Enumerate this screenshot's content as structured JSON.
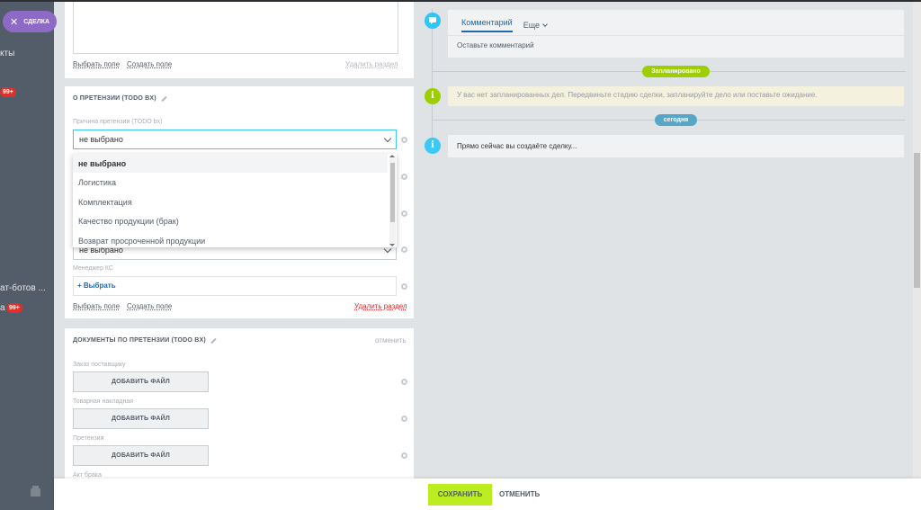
{
  "deal_pill": {
    "label": "СДЕЛКА"
  },
  "left_nav": {
    "items": [
      {
        "label": "кты"
      },
      {
        "label": "ат-ботов ..."
      },
      {
        "label": "а"
      }
    ],
    "badges": [
      "99+",
      "99+"
    ]
  },
  "card1": {
    "select_field": "Выбрать поле",
    "create_field": "Создать поле",
    "delete_section": "Удалить раздел"
  },
  "claim_section": {
    "title": "О ПРЕТЕНЗИИ (TODO BX)",
    "reason_label": "Причина претензии (TODO bx)",
    "reason_value": "не выбрано",
    "second_select_value": "не выбрано",
    "manager_label": "Менеджер КС",
    "pick_button": "+ Выбрать",
    "select_field": "Выбрать поле",
    "create_field": "Создать поле",
    "delete_section": "Удалить раздел"
  },
  "dropdown": {
    "options": [
      "не выбрано",
      "Логистика",
      "Комплектация",
      "Качество продукции (брак)",
      "Возврат просроченной продукции"
    ]
  },
  "docs_section": {
    "title": "ДОКУМЕНТЫ ПО ПРЕТЕНЗИИ (TODO BX)",
    "cancel": "отменить",
    "fields": [
      {
        "label": "Заказ поставщику",
        "button": "ДОБАВИТЬ ФАЙЛ"
      },
      {
        "label": "Товарная накладная",
        "button": "ДОБАВИТЬ ФАЙЛ"
      },
      {
        "label": "Претензия",
        "button": "ДОБАВИТЬ ФАЙЛ"
      },
      {
        "label": "Акт брака"
      }
    ]
  },
  "timeline": {
    "tabs": {
      "comment": "Комментарий",
      "more": "Еще"
    },
    "comment_placeholder": "Оставьте комментарий",
    "planned_badge": "Запланировано",
    "planned_text": "У вас нет запланированных дел. Передвиньте стадию сделки, запланируйте дело или поставьте ожидание.",
    "today_badge": "сегодня",
    "creating_text": "Прямо сейчас вы создаёте сделку...",
    "info_glyph": "i",
    "colors": {
      "comment_icon": "#2fc6f6",
      "planned": "#9dcf00",
      "info": "#a8adb4",
      "today": "#55a6c9",
      "info_today": "#3bc8f5"
    }
  },
  "footer": {
    "save": "СОХРАНИТЬ",
    "cancel": "ОТМЕНИТЬ"
  }
}
